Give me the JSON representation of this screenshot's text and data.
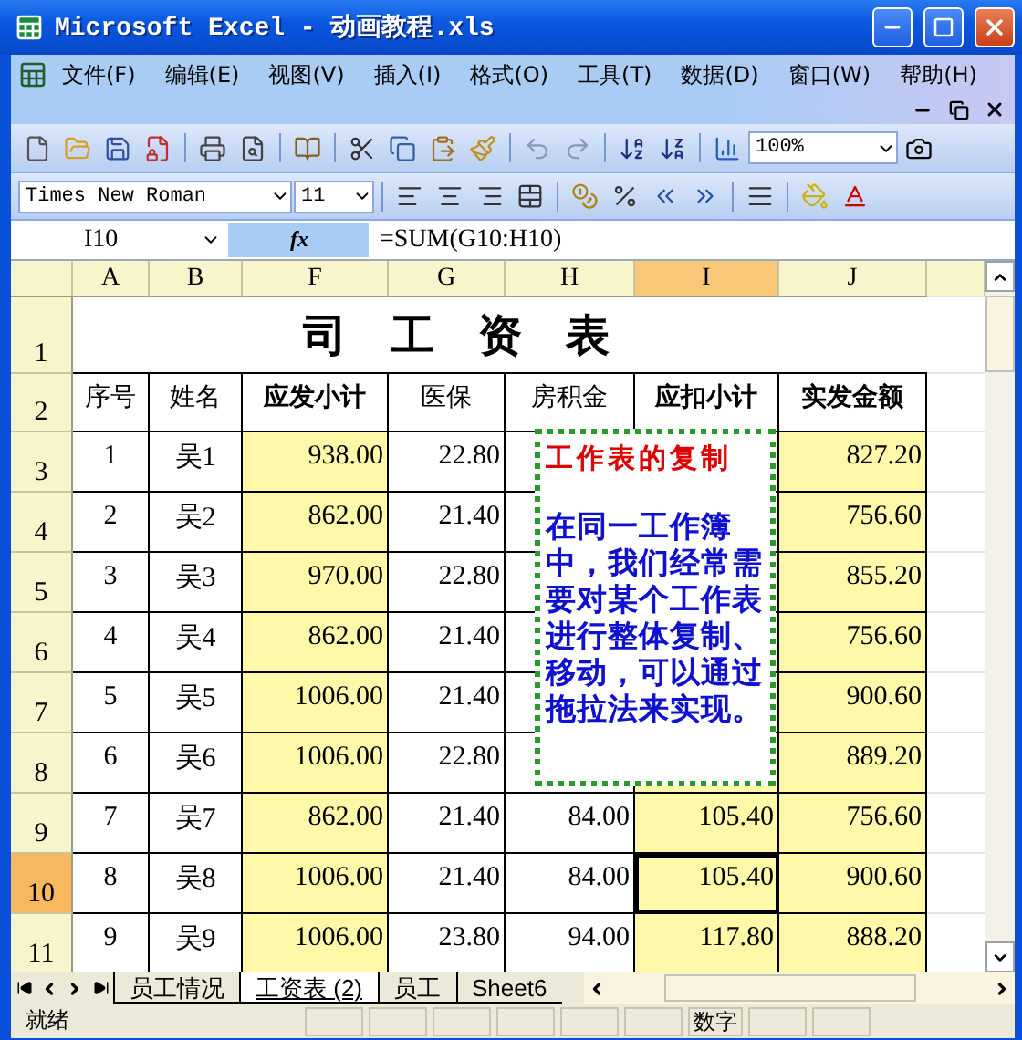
{
  "window": {
    "title": "Microsoft Excel - 动画教程.xls"
  },
  "menu": [
    "文件(F)",
    "编辑(E)",
    "视图(V)",
    "插入(I)",
    "格式(O)",
    "工具(T)",
    "数据(D)",
    "窗口(W)",
    "帮助(H)"
  ],
  "standard_toolbar": {
    "zoom": "100%"
  },
  "formatting_toolbar": {
    "font": "Times New Roman",
    "size": "11"
  },
  "formula_bar": {
    "name_box": "I10",
    "function_label": "fx",
    "formula": "=SUM(G10:H10)"
  },
  "sheet": {
    "columns": [
      {
        "label": "A",
        "selected": false,
        "shaded": false
      },
      {
        "label": "B",
        "selected": false,
        "shaded": false
      },
      {
        "label": "F",
        "selected": false,
        "shaded": true
      },
      {
        "label": "G",
        "selected": false,
        "shaded": false
      },
      {
        "label": "H",
        "selected": false,
        "shaded": false
      },
      {
        "label": "I",
        "selected": true,
        "shaded": true
      },
      {
        "label": "J",
        "selected": false,
        "shaded": true
      }
    ],
    "title_row": {
      "number": "1",
      "selected": false,
      "title": "司　工　资　表"
    },
    "header_row": {
      "number": "2",
      "selected": false,
      "cells": [
        {
          "text": "序号",
          "bold": false
        },
        {
          "text": "姓名",
          "bold": false
        },
        {
          "text": "应发小计",
          "bold": true
        },
        {
          "text": "医保",
          "bold": false
        },
        {
          "text": "房积金",
          "bold": false
        },
        {
          "text": "应扣小计",
          "bold": true
        },
        {
          "text": "实发金额",
          "bold": true
        }
      ]
    },
    "rows": [
      {
        "number": "3",
        "selected": false,
        "cells": [
          "1",
          "吴1",
          "938.00",
          "22.80",
          null,
          null,
          "827.20"
        ]
      },
      {
        "number": "4",
        "selected": false,
        "cells": [
          "2",
          "吴2",
          "862.00",
          "21.40",
          null,
          null,
          "756.60"
        ]
      },
      {
        "number": "5",
        "selected": false,
        "cells": [
          "3",
          "吴3",
          "970.00",
          "22.80",
          null,
          null,
          "855.20"
        ]
      },
      {
        "number": "6",
        "selected": false,
        "cells": [
          "4",
          "吴4",
          "862.00",
          "21.40",
          null,
          null,
          "756.60"
        ]
      },
      {
        "number": "7",
        "selected": false,
        "cells": [
          "5",
          "吴5",
          "1006.00",
          "21.40",
          null,
          null,
          "900.60"
        ]
      },
      {
        "number": "8",
        "selected": false,
        "cells": [
          "6",
          "吴6",
          "1006.00",
          "22.80",
          null,
          null,
          "889.20"
        ]
      },
      {
        "number": "9",
        "selected": false,
        "cells": [
          "7",
          "吴7",
          "862.00",
          "21.40",
          "84.00",
          "105.40",
          "756.60"
        ]
      },
      {
        "number": "10",
        "selected": true,
        "cells": [
          "8",
          "吴8",
          "1006.00",
          "21.40",
          "84.00",
          "105.40",
          "900.60"
        ]
      },
      {
        "number": "11",
        "selected": false,
        "cells": [
          "9",
          "吴9",
          "1006.00",
          "23.80",
          "94.00",
          "117.80",
          "888.20"
        ]
      }
    ],
    "comment": {
      "title": "工作表的复制",
      "body": "在同一工作簿中，我们经常需要对某个工作表进行整体复制、移动，可以通过拖拉法来实现。"
    }
  },
  "sheet_tabs": [
    {
      "label": "员工情况",
      "selected": false
    },
    {
      "label": "工资表 (2)",
      "selected": true
    },
    {
      "label": "员工",
      "selected": false
    },
    {
      "label": "Sheet6",
      "selected": false
    }
  ],
  "status_bar": {
    "text": "就绪",
    "mode": "数字"
  }
}
